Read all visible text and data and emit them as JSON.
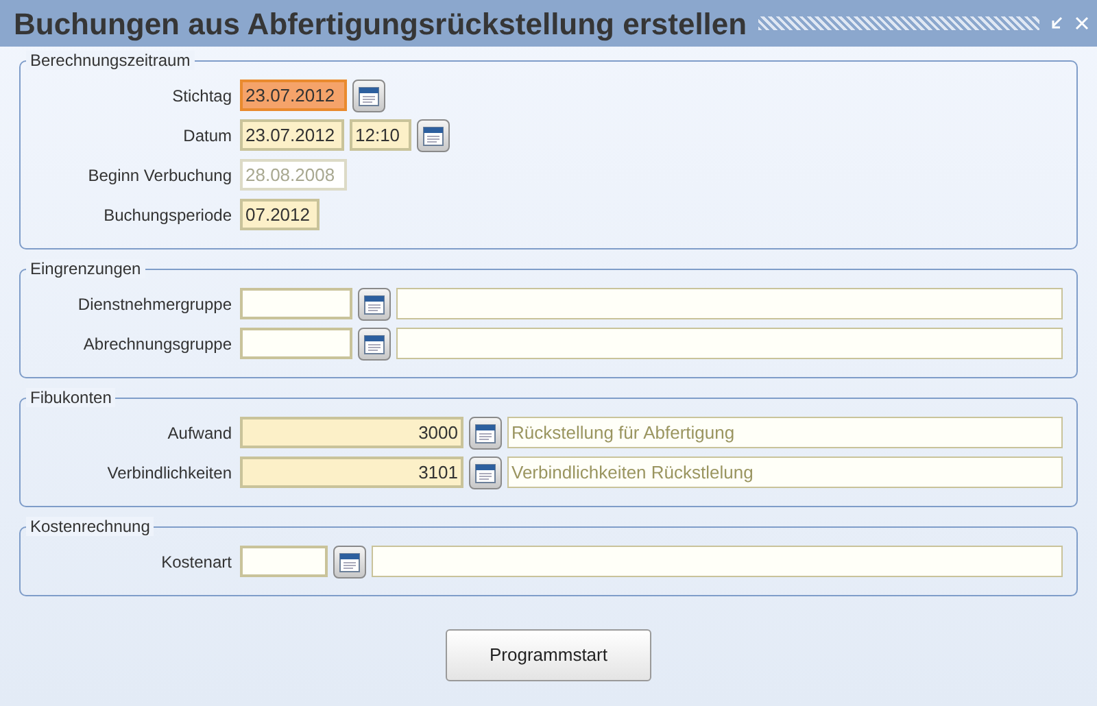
{
  "window": {
    "title": "Buchungen aus Abfertigungsrückstellung erstellen"
  },
  "sections": [
    {
      "title": "Berechnungszeitraum",
      "rows": [
        {
          "label": "Stichtag",
          "kind": "date",
          "picker": true,
          "fields": [
            {
              "value": "23.07.2012",
              "focused": true,
              "required": true,
              "disabled": false,
              "readonly": false
            }
          ]
        },
        {
          "label": "Datum",
          "kind": "datetime",
          "picker": true,
          "fields": [
            {
              "value": "23.07.2012",
              "focused": false,
              "required": true,
              "disabled": false,
              "readonly": false
            },
            {
              "value": "12:10",
              "focused": false,
              "required": true,
              "disabled": false,
              "readonly": false
            }
          ]
        },
        {
          "label": "Beginn Verbuchung",
          "kind": "date",
          "picker": false,
          "fields": [
            {
              "value": "28.08.2008",
              "focused": false,
              "required": false,
              "disabled": true,
              "readonly": false
            }
          ]
        },
        {
          "label": "Buchungsperiode",
          "kind": "period",
          "picker": false,
          "fields": [
            {
              "value": "07.2012",
              "focused": false,
              "required": true,
              "disabled": false,
              "readonly": false
            }
          ]
        }
      ]
    },
    {
      "title": "Eingrenzungen",
      "rows": [
        {
          "label": "Dienstnehmergruppe",
          "kind": "lookup",
          "picker": true,
          "fields": [
            {
              "focused": false,
              "required": false,
              "disabled": false,
              "readonly": false
            },
            {
              "focused": false,
              "required": false,
              "disabled": false,
              "readonly": true
            }
          ]
        },
        {
          "label": "Abrechnungsgruppe",
          "kind": "lookup",
          "picker": true,
          "fields": [
            {
              "focused": false,
              "required": false,
              "disabled": false,
              "readonly": false
            },
            {
              "focused": false,
              "required": false,
              "disabled": false,
              "readonly": true
            }
          ]
        }
      ]
    },
    {
      "title": "Fibukonten",
      "rows": [
        {
          "label": "Aufwand",
          "kind": "account",
          "picker": true,
          "fields": [
            {
              "value": "3000",
              "focused": false,
              "required": true,
              "disabled": false,
              "readonly": false
            },
            {
              "value": "Rückstellung für Abfertigung",
              "focused": false,
              "required": false,
              "disabled": false,
              "readonly": true
            }
          ]
        },
        {
          "label": "Verbindlichkeiten",
          "kind": "account",
          "picker": true,
          "fields": [
            {
              "value": "3101",
              "focused": false,
              "required": true,
              "disabled": false,
              "readonly": false
            },
            {
              "value": "Verbindlichkeiten Rückstlelung",
              "focused": false,
              "required": false,
              "disabled": false,
              "readonly": true
            }
          ]
        }
      ]
    },
    {
      "title": "Kostenrechnung",
      "rows": [
        {
          "label": "Kostenart",
          "kind": "short-lookup",
          "picker": true,
          "fields": [
            {
              "focused": false,
              "required": false,
              "disabled": false,
              "readonly": false
            },
            {
              "focused": false,
              "required": false,
              "disabled": false,
              "readonly": true
            }
          ]
        }
      ]
    }
  ],
  "start_button": {
    "label": "Programmstart"
  }
}
